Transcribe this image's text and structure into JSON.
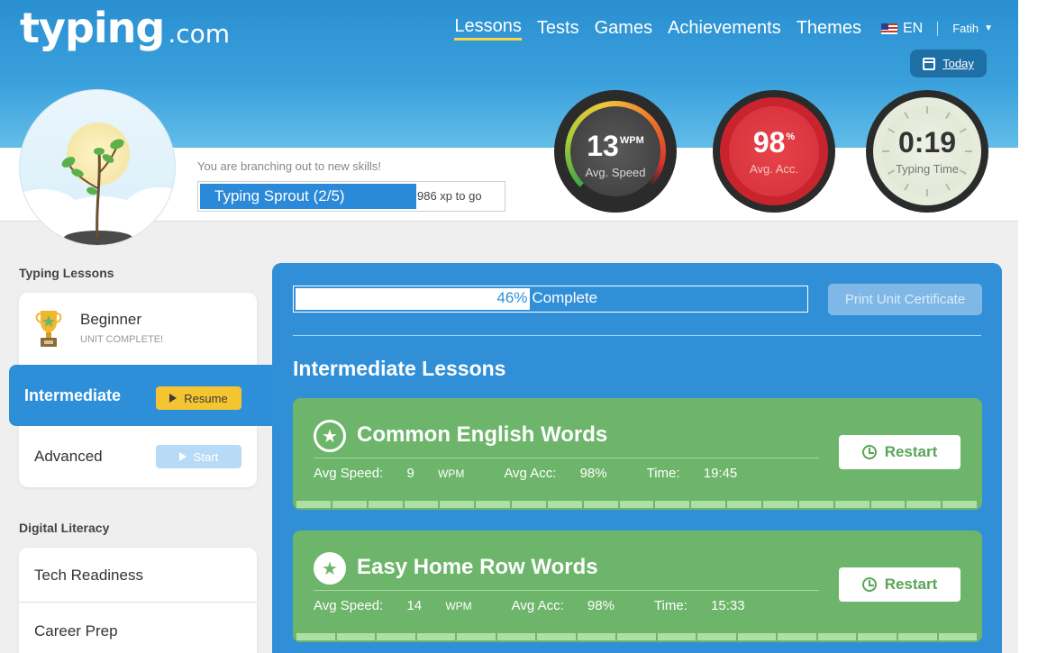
{
  "brand": {
    "name": "typing",
    "tld": ".com"
  },
  "nav": {
    "items": [
      "Lessons",
      "Tests",
      "Games",
      "Achievements",
      "Themes"
    ],
    "active": "Lessons",
    "language": "EN",
    "user": "Fatih"
  },
  "today_button": "Today",
  "profile": {
    "tagline": "You are branching out to new skills!",
    "level": "Typing Sprout (2/5)",
    "xp_to_go": "986 xp to go"
  },
  "stats": {
    "speed": {
      "value": "13",
      "unit": "WPM",
      "label": "Avg. Speed"
    },
    "accuracy": {
      "value": "98",
      "unit": "%",
      "label": "Avg. Acc."
    },
    "time": {
      "value": "0:19",
      "label": "Typing Time"
    }
  },
  "sidebar": {
    "typing_title": "Typing Lessons",
    "beginner": {
      "label": "Beginner",
      "status": "UNIT COMPLETE!"
    },
    "intermediate": {
      "label": "Intermediate",
      "button": "Resume"
    },
    "advanced": {
      "label": "Advanced",
      "button": "Start"
    },
    "digital_title": "Digital Literacy",
    "digital_items": [
      "Tech Readiness",
      "Career Prep"
    ]
  },
  "unit": {
    "progress_pct": "46%",
    "progress_fraction": 0.46,
    "progress_label": "Complete",
    "certificate_button": "Print Unit Certificate",
    "section_title": "Intermediate Lessons"
  },
  "lessons": [
    {
      "title": "Common English Words",
      "speed_label": "Avg Speed:",
      "speed": "9",
      "speed_unit": "WPM",
      "acc_label": "Avg Acc:",
      "acc": "98%",
      "time_label": "Time:",
      "time": "19:45",
      "button": "Restart"
    },
    {
      "title": "Easy Home Row Words",
      "speed_label": "Avg Speed:",
      "speed": "14",
      "speed_unit": "WPM",
      "acc_label": "Avg Acc:",
      "acc": "98%",
      "time_label": "Time:",
      "time": "15:33",
      "button": "Restart"
    }
  ],
  "icons": [
    "trophy-icon",
    "star-icon",
    "restart-icon",
    "calendar-icon",
    "flag-icon",
    "chevron-down-icon",
    "play-icon"
  ],
  "colors": {
    "header_blue": "#2a8fd0",
    "panel_blue": "#318fd8",
    "lesson_green": "#6db56a",
    "resume_yellow": "#f5c431"
  }
}
